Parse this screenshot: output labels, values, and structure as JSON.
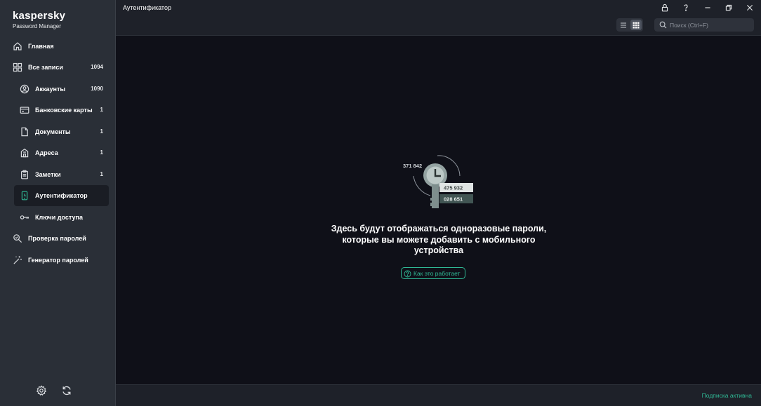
{
  "brand": {
    "name": "kaspersky",
    "subtitle": "Password Manager"
  },
  "sidebar": {
    "items": [
      {
        "label": "Главная",
        "count": "",
        "icon": "home-icon"
      },
      {
        "label": "Все записи",
        "count": "1094",
        "icon": "grid-icon"
      },
      {
        "label": "Аккаунты",
        "count": "1090",
        "icon": "user-circle-icon"
      },
      {
        "label": "Банковские карты",
        "count": "1",
        "icon": "credit-card-icon"
      },
      {
        "label": "Документы",
        "count": "1",
        "icon": "document-icon"
      },
      {
        "label": "Адреса",
        "count": "1",
        "icon": "building-icon"
      },
      {
        "label": "Заметки",
        "count": "1",
        "icon": "clipboard-icon"
      },
      {
        "label": "Аутентификатор",
        "count": "",
        "icon": "authenticator-icon",
        "active": true
      },
      {
        "label": "Ключи доступа",
        "count": "",
        "icon": "key-icon"
      },
      {
        "label": "Проверка паролей",
        "count": "",
        "icon": "magnifier-check-icon"
      },
      {
        "label": "Генератор паролей",
        "count": "",
        "icon": "magic-wand-icon"
      }
    ],
    "footer": {
      "settings_icon": "gear-icon",
      "sync_icon": "sync-icon"
    }
  },
  "header": {
    "title": "Аутентификатор",
    "search": {
      "placeholder": "Поиск (Ctrl+F)",
      "value": ""
    },
    "view_modes": {
      "list_icon": "list-icon",
      "tile_icon": "tile-grid-icon",
      "selected": "tile"
    }
  },
  "empty_state": {
    "codes": [
      "371 842",
      "475 932",
      "028 651"
    ],
    "message": "Здесь будут отображаться одноразовые пароли, которые вы можете добавить с мобильного устройства",
    "link_label": "Как это работает"
  },
  "status": {
    "subscription": "Подписка активна"
  },
  "colors": {
    "accent": "#2fb894",
    "sidebar_bg": "#2a2f37",
    "content_bg": "#0f1018",
    "header_bg": "#1e2129"
  }
}
